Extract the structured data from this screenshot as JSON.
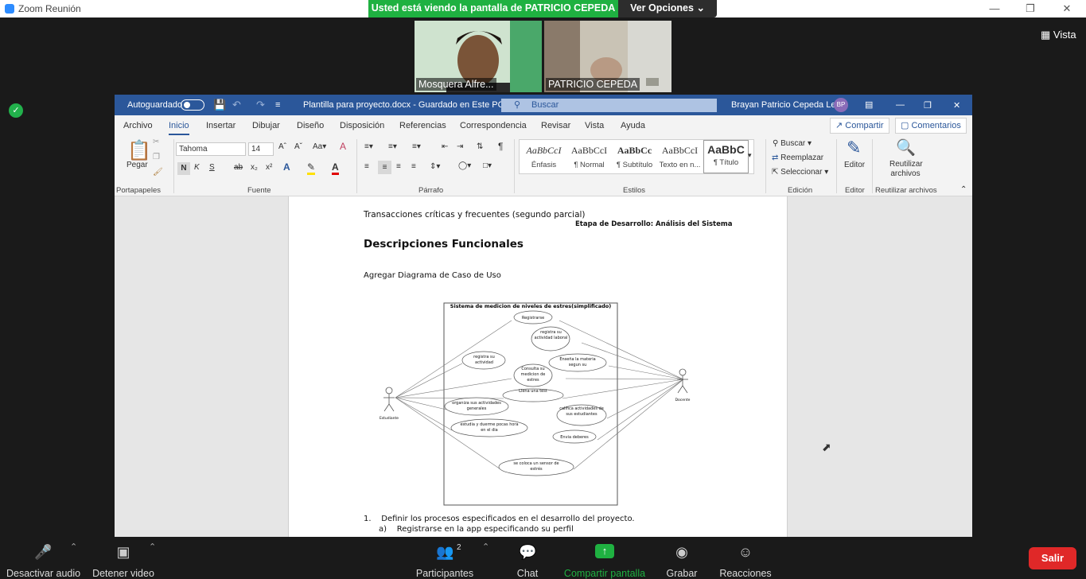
{
  "zoom_window": {
    "title": "Zoom Reunión",
    "share_banner": "Usted está viendo la pantalla de PATRICIO CEPEDA",
    "view_options": "Ver Opciones",
    "view_button": "Vista"
  },
  "participants_video": [
    {
      "name": "Mosquera Alfre..."
    },
    {
      "name": "PATRICIO CEPEDA"
    }
  ],
  "word": {
    "autosave_label": "Autoguardado",
    "doc_title": "Plantilla para proyecto.docx  -  Guardado en Este PC",
    "search_placeholder": "Buscar",
    "user_name": "Brayan Patricio Cepeda Leon",
    "user_initials": "BP",
    "menu_tabs": [
      "Archivo",
      "Inicio",
      "Insertar",
      "Dibujar",
      "Diseño",
      "Disposición",
      "Referencias",
      "Correspondencia",
      "Revisar",
      "Vista",
      "Ayuda"
    ],
    "share_btn": "Compartir",
    "comments_btn": "Comentarios",
    "ribbon": {
      "paste_label": "Pegar",
      "font_name": "Tahoma",
      "font_size": "14",
      "bold": "N",
      "italic": "K",
      "underline": "S",
      "groups": [
        "Portapapeles",
        "Fuente",
        "Párrafo",
        "Estilos",
        "Edición",
        "Editor",
        "Reutilizar archivos"
      ],
      "styles": [
        {
          "preview": "AaBbCcI",
          "label": "Énfasis"
        },
        {
          "preview": "AaBbCcI",
          "label": "¶ Normal"
        },
        {
          "preview": "AaBbCc",
          "label": "¶ Subtítulo"
        },
        {
          "preview": "AaBbCcI",
          "label": "Texto en n..."
        },
        {
          "preview": "AaBbC",
          "label": "¶ Título"
        }
      ],
      "buscar": "Buscar",
      "reemplazar": "Reemplazar",
      "seleccionar": "Seleccionar",
      "editor": "Editor",
      "reutilizar": "Reutilizar archivos"
    },
    "document": {
      "line1": "Transacciones críticas y frecuentes (segundo parcial)",
      "stage": "Etapa de Desarrollo: Análisis del Sistema",
      "heading": "Descripciones Funcionales",
      "add_diagram": "Agregar Diagrama de Caso de Uso",
      "list_item_1": "1.    Definir los procesos especificados en el desarrollo del proyecto.",
      "list_item_1a": "a)    Registrarse en la app especificando su perfil"
    },
    "diagram": {
      "system_title": "Sistema de medicion de niveles de estres(simplificado)",
      "actor_left": "Estudiante",
      "actor_right": "Docente",
      "use_cases": [
        "Registrarse",
        "registra su actividad laboral",
        "registra su actividad",
        "Enseña la materia segun su",
        "Consulta su medicion de estres",
        "Llena una test",
        "organiza sus actividades generales",
        "califica actividades de sus estudiantes",
        "estudia y duerme pocas hora en el dia",
        "Envia deberes",
        "se coloca un sensor de estrés"
      ]
    }
  },
  "toolbar": {
    "audio": "Desactivar audio",
    "video": "Detener video",
    "participants": "Participantes",
    "participants_count": "2",
    "chat": "Chat",
    "share": "Compartir pantalla",
    "record": "Grabar",
    "reactions": "Reacciones",
    "leave": "Salir"
  }
}
